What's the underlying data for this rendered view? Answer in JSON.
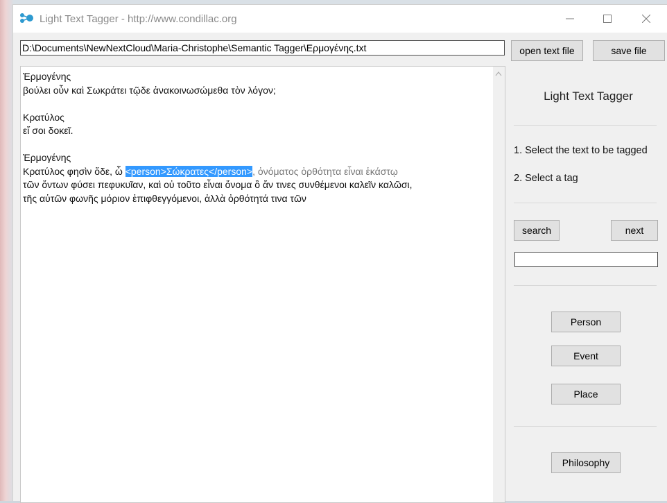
{
  "window": {
    "title": "Light Text Tagger - http://www.condillac.org",
    "controls": {
      "minimize": "minimize-icon",
      "maximize": "maximize-icon",
      "close": "close-icon"
    }
  },
  "toolbar": {
    "file_path": "D:\\Documents\\NewNextCloud\\Maria-Christophe\\Semantic Tagger\\Ερμογένης.txt",
    "open_label": "open text file",
    "save_label": "save file"
  },
  "editor": {
    "lines": [
      "Ἑρμογένης",
      "βούλει οὖν καὶ Σωκράτει τῷδε ἀνακοινωσώμεθα τὸν λόγον;",
      "",
      "Κρατύλος",
      "εἴ σοι δοκεῖ.",
      "",
      "Ἑρμογένης"
    ],
    "tagged_line": {
      "before": "Κρατύλος φησὶν ὅδε, ὦ ",
      "selected": "<person>Σώκρατες</person>",
      "after": ", ὀνόματος ὀρθότητα εἶναι ἑκάστῳ"
    },
    "lines_after": [
      "τῶν ὄντων φύσει πεφυκυῖαν, καὶ οὐ τοῦτο εἶναι ὄνομα ὃ ἄν τινες συνθέμενοι καλεῖν καλῶσι,",
      "τῆς αὑτῶν φωνῆς μόριον ἐπιφθεγγόμενοι, ἀλλὰ ὀρθότητά τινα τῶν"
    ]
  },
  "sidebar": {
    "title": "Light Text Tagger",
    "step1": "1. Select the text to be tagged",
    "step2": "2. Select a tag",
    "search_label": "search",
    "next_label": "next",
    "search_value": "",
    "tags": [
      "Person",
      "Event",
      "Place",
      "Philosophy"
    ]
  },
  "colors": {
    "selection": "#3399ff",
    "window_bg": "#f0f0f0",
    "button_bg": "#e1e1e1"
  }
}
